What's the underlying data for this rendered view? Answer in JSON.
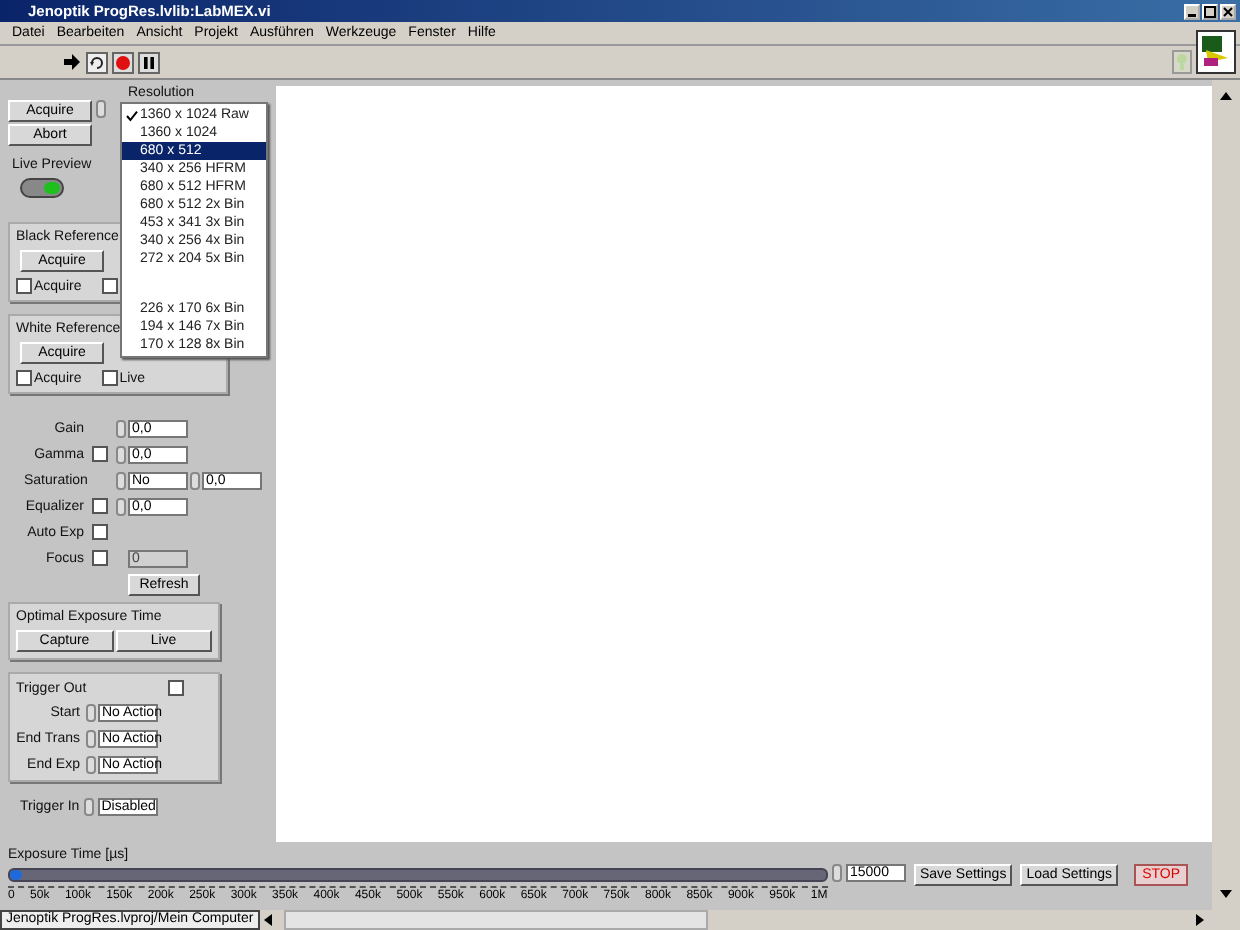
{
  "window": {
    "title": "Jenoptik ProgRes.lvlib:LabMEX.vi"
  },
  "menu": [
    "Datei",
    "Bearbeiten",
    "Ansicht",
    "Projekt",
    "Ausführen",
    "Werkzeuge",
    "Fenster",
    "Hilfe"
  ],
  "acquisition": {
    "acquire_button": "Acquire",
    "abort_button": "Abort",
    "resolution_label": "Resolution",
    "live_preview_label": "Live Preview",
    "live_preview_on": true
  },
  "resolution_menu": [
    {
      "kind": "item",
      "label": "1360 x 1024 Raw",
      "checked": true,
      "selected": false
    },
    {
      "kind": "item",
      "label": "1360 x 1024",
      "checked": false,
      "selected": false
    },
    {
      "kind": "item",
      "label": "680 x 512",
      "checked": false,
      "selected": true
    },
    {
      "kind": "item",
      "label": "340 x 256 HFRM",
      "checked": false,
      "selected": false
    },
    {
      "kind": "item",
      "label": "680 x 512 HFRM",
      "checked": false,
      "selected": false
    },
    {
      "kind": "item",
      "label": "680 x 512 2x Bin",
      "checked": false,
      "selected": false
    },
    {
      "kind": "item",
      "label": "453 x 341 3x Bin",
      "checked": false,
      "selected": false
    },
    {
      "kind": "item",
      "label": "340 x 256 4x Bin",
      "checked": false,
      "selected": false
    },
    {
      "kind": "item",
      "label": "272 x 204 5x Bin",
      "checked": false,
      "selected": false
    },
    {
      "kind": "gap"
    },
    {
      "kind": "item",
      "label": "226 x 170 6x Bin",
      "checked": false,
      "selected": false
    },
    {
      "kind": "item",
      "label": "194 x 146 7x Bin",
      "checked": false,
      "selected": false
    },
    {
      "kind": "item",
      "label": "170 x 128 8x Bin",
      "checked": false,
      "selected": false
    }
  ],
  "references": [
    {
      "title": "Black Reference",
      "button": "Acquire",
      "checkboxes": [
        {
          "label": "Acquire",
          "checked": false
        },
        {
          "checked": false
        }
      ]
    },
    {
      "title": "White Reference",
      "button": "Acquire",
      "checkboxes": [
        {
          "label": "Acquire",
          "checked": false
        },
        {
          "label": "Live",
          "checked": false
        }
      ]
    }
  ],
  "parameters": [
    {
      "label": "Gain",
      "fields": [
        {
          "kind": "spin",
          "value": "0,0",
          "disabled": false
        }
      ]
    },
    {
      "label": "Gamma",
      "checked": false,
      "fields": [
        {
          "kind": "spin",
          "value": "0,0",
          "disabled": false
        }
      ]
    },
    {
      "label": "Saturation",
      "fields": [
        {
          "kind": "spin",
          "value": "No",
          "disabled": false
        },
        {
          "kind": "spin",
          "value": "0,0",
          "disabled": false
        }
      ]
    },
    {
      "label": "Equalizer",
      "checked": false,
      "fields": [
        {
          "kind": "spin",
          "value": "0,0",
          "disabled": false
        }
      ]
    },
    {
      "label": "Auto Exp",
      "checked": false
    },
    {
      "label": "Focus",
      "checked": false,
      "fields": [
        {
          "kind": "plain",
          "value": "0",
          "disabled": true
        }
      ]
    }
  ],
  "refresh_button": "Refresh",
  "optimal_exposure": {
    "title": "Optimal Exposure Time",
    "buttons": [
      "Capture",
      "Live"
    ]
  },
  "trigger_out": {
    "title": "Trigger Out",
    "checked": false,
    "rows": [
      {
        "label": "Start",
        "value": "No Action"
      },
      {
        "label": "End Trans",
        "value": "No Action"
      },
      {
        "label": "End Exp",
        "value": "No Action"
      }
    ]
  },
  "trigger_in": {
    "label": "Trigger In",
    "value": "Disabled"
  },
  "exposure": {
    "label": "Exposure Time [µs]",
    "level": 0.015,
    "ticks": [
      "0",
      "50k",
      "100k",
      "150k",
      "200k",
      "250k",
      "300k",
      "350k",
      "400k",
      "450k",
      "500k",
      "550k",
      "600k",
      "650k",
      "700k",
      "750k",
      "800k",
      "850k",
      "900k",
      "950k",
      "1M"
    ],
    "value": "15000"
  },
  "buttons": [
    "Save Settings",
    "Load Settings"
  ],
  "stop_button": "STOP",
  "status_bar": {
    "path": "Jenoptik ProgRes.lvproj/Mein Computer"
  }
}
